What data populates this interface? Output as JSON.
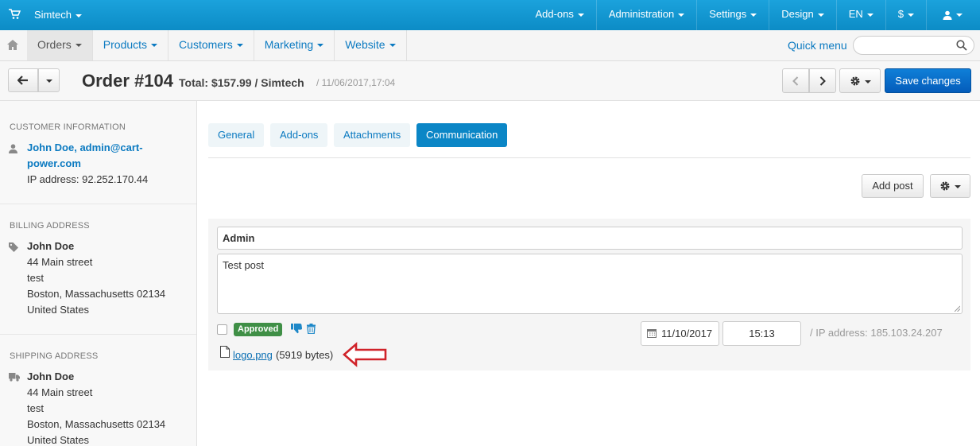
{
  "topbar": {
    "brand": "Simtech",
    "menu": [
      "Add-ons",
      "Administration",
      "Settings",
      "Design",
      "EN",
      "$"
    ]
  },
  "navbar": {
    "items": [
      "Orders",
      "Products",
      "Customers",
      "Marketing",
      "Website"
    ],
    "quick_menu": "Quick menu",
    "search_placeholder": ""
  },
  "header": {
    "title": "Order #104",
    "subtitle": "Total: $157.99 / Simtech",
    "date": "/ 11/06/2017,17:04",
    "save_label": "Save changes"
  },
  "sidebar": {
    "customer": {
      "title": "Customer information",
      "name_line1": "John Doe, admin@cart-",
      "name_line2": "power.com",
      "ip": "IP address: 92.252.170.44"
    },
    "billing": {
      "title": "Billing address",
      "lines": [
        "John Doe",
        "44 Main street",
        "test",
        "Boston, Massachusetts 02134",
        "United States"
      ]
    },
    "shipping": {
      "title": "Shipping address",
      "lines": [
        "John Doe",
        "44 Main street",
        "test",
        "Boston, Massachusetts 02134",
        "United States"
      ]
    }
  },
  "tabs": [
    "General",
    "Add-ons",
    "Attachments",
    "Communication"
  ],
  "toolbar": {
    "add_post": "Add post"
  },
  "post": {
    "author": "Admin",
    "message": "Test post",
    "status": "Approved",
    "date": "11/10/2017",
    "time": "15:13",
    "ip": "/ IP address: 185.103.24.207",
    "file_name": "logo.png",
    "file_size": "(5919 bytes)"
  },
  "colors": {
    "topbar": "#0c8cc6",
    "link": "#0b7ac1",
    "primary_button": "#045cbb",
    "approved": "#3f8f46",
    "annotation_arrow": "#d0232a"
  }
}
